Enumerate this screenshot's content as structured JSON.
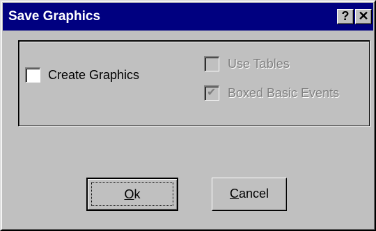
{
  "window": {
    "title": "Save Graphics",
    "help_glyph": "?",
    "close_glyph": "✕"
  },
  "options": {
    "create_graphics": {
      "label": "Create Graphics",
      "checked": false,
      "enabled": true
    },
    "use_tables": {
      "label": "Use Tables",
      "checked": false,
      "enabled": false
    },
    "boxed_basic_events": {
      "label": "Boxed Basic Events",
      "checked": true,
      "enabled": false,
      "check_glyph": "✔"
    }
  },
  "buttons": {
    "ok": {
      "accel": "O",
      "rest": "k"
    },
    "cancel": {
      "accel": "C",
      "rest": "ancel"
    }
  },
  "colors": {
    "titlebar": "#000080",
    "face": "#c0c0c0",
    "disabled_text": "#808080"
  }
}
